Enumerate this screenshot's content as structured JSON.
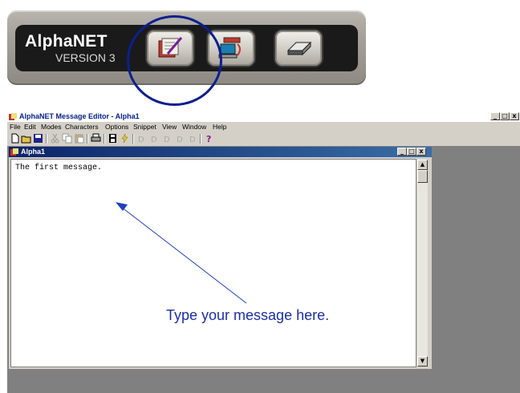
{
  "launcher": {
    "logo_name": "AlphaNET",
    "logo_version": "VERSION 3",
    "buttons": [
      {
        "icon": "message-editor-icon",
        "highlighted": true
      },
      {
        "icon": "sign-communication-icon",
        "highlighted": false
      },
      {
        "icon": "network-device-icon",
        "highlighted": false
      }
    ],
    "highlight_color": "#0d1f8f"
  },
  "editor": {
    "title": "AlphaNET Message Editor - Alpha1",
    "window_buttons": [
      "_",
      "□",
      "x"
    ],
    "menu": [
      "File",
      "Edit",
      "Modes",
      "Characters",
      "Options",
      "Snippet",
      "View",
      "Window",
      "Help"
    ],
    "toolbar_icons": [
      "new-icon",
      "open-icon",
      "save-icon",
      "cut-icon",
      "copy-icon",
      "paste-icon",
      "print-icon",
      "save-sign-icon",
      "lightning-icon",
      "font-1-icon",
      "font-2-icon",
      "font-3-icon",
      "font-4-icon",
      "font-5-icon",
      "help-icon"
    ],
    "child_window": {
      "title": "Alpha1",
      "text": "The first message."
    }
  },
  "annotation": {
    "text": "Type your message here.",
    "color": "#1b2fa8"
  }
}
